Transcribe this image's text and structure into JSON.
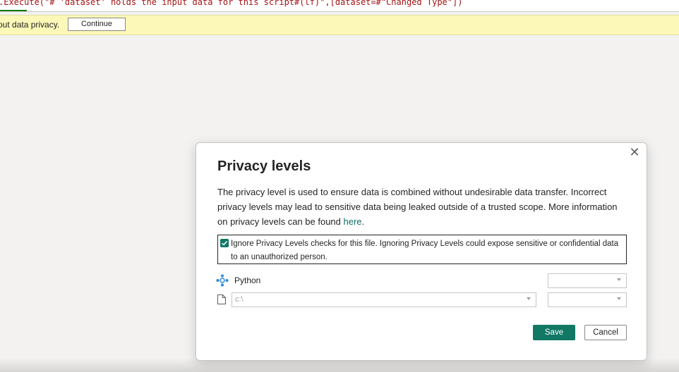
{
  "formula_bar": {
    "text": ".Execute(\"# 'dataset' holds the input data for this script#(lf)\",[dataset=#\"Changed Type\"])"
  },
  "warning_bar": {
    "message": "out data privacy.",
    "continue_label": "Continue"
  },
  "dialog": {
    "title": "Privacy levels",
    "description": "The privacy level is used to ensure data is combined without undesirable data transfer. Incorrect privacy levels may lead to sensitive data being leaked outside of a trusted scope. More information on privacy levels can be found ",
    "link_text": "here",
    "description_end": ".",
    "ignore_checkbox": {
      "checked": true,
      "label": "Ignore Privacy Levels checks for this file. Ignoring Privacy Levels could expose sensitive or confidential data to an unauthorized person."
    },
    "sources": [
      {
        "icon": "python-icon",
        "label": "Python",
        "privacy_level": ""
      },
      {
        "icon": "file-icon",
        "path_value": "c:\\",
        "privacy_level": ""
      }
    ],
    "save_label": "Save",
    "cancel_label": "Cancel"
  },
  "colors": {
    "accent": "#117865",
    "link": "#0f6b66",
    "warning_bg": "#fbf8b8",
    "formula_text": "#a31515"
  }
}
